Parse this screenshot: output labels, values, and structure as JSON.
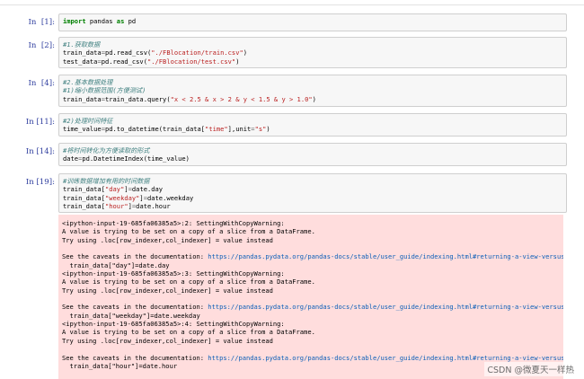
{
  "cells": [
    {
      "prompt": "In  [1]:",
      "lines": [
        [
          {
            "t": "import",
            "c": "kw"
          },
          {
            "t": " pandas "
          },
          {
            "t": "as",
            "c": "kw"
          },
          {
            "t": " pd"
          }
        ]
      ]
    },
    {
      "prompt": "In  [2]:",
      "lines": [
        [
          {
            "t": "#1.获取数据",
            "c": "cm"
          }
        ],
        [
          {
            "t": "train_data"
          },
          {
            "t": "=",
            "c": "nm"
          },
          {
            "t": "pd.read_csv("
          },
          {
            "t": "\"./FBlocation/train.csv\"",
            "c": "st"
          },
          {
            "t": ")"
          }
        ],
        [
          {
            "t": "test_data"
          },
          {
            "t": "=",
            "c": "nm"
          },
          {
            "t": "pd.read_csv("
          },
          {
            "t": "\"./FBlocation/test.csv\"",
            "c": "st"
          },
          {
            "t": ")"
          }
        ]
      ]
    },
    {
      "prompt": "In  [4]:",
      "lines": [
        [
          {
            "t": "#2.基本数据处理",
            "c": "cm"
          }
        ],
        [
          {
            "t": "#1)缩小数据范围(方便测试)",
            "c": "cm"
          }
        ],
        [
          {
            "t": "train_data"
          },
          {
            "t": "=",
            "c": "nm"
          },
          {
            "t": "train_data.query("
          },
          {
            "t": "\"x < 2.5 & x > 2 & y < 1.5 & y > 1.0\"",
            "c": "st"
          },
          {
            "t": ")"
          }
        ]
      ]
    },
    {
      "prompt": "In [11]:",
      "lines": [
        [
          {
            "t": "#2)处理时间特征",
            "c": "cm"
          }
        ],
        [
          {
            "t": "time_value"
          },
          {
            "t": "=",
            "c": "nm"
          },
          {
            "t": "pd.to_datetime(train_data["
          },
          {
            "t": "\"time\"",
            "c": "st"
          },
          {
            "t": "],unit"
          },
          {
            "t": "=",
            "c": "nm"
          },
          {
            "t": "\"s\"",
            "c": "st"
          },
          {
            "t": ")"
          }
        ]
      ]
    },
    {
      "prompt": "In [14]:",
      "lines": [
        [
          {
            "t": "#将时间转化为方便读取的形式",
            "c": "cm"
          }
        ],
        [
          {
            "t": "date"
          },
          {
            "t": "=",
            "c": "nm"
          },
          {
            "t": "pd.DatetimeIndex(time_value)"
          }
        ]
      ]
    },
    {
      "prompt": "In [19]:",
      "lines": [
        [
          {
            "t": "#训练数据增加有用的时间数据",
            "c": "cm"
          }
        ],
        [
          {
            "t": "train_data["
          },
          {
            "t": "\"day\"",
            "c": "st"
          },
          {
            "t": "]"
          },
          {
            "t": "=",
            "c": "nm"
          },
          {
            "t": "date.day"
          }
        ],
        [
          {
            "t": "train_data["
          },
          {
            "t": "\"weekday\"",
            "c": "st"
          },
          {
            "t": "]"
          },
          {
            "t": "=",
            "c": "nm"
          },
          {
            "t": "date.weekday"
          }
        ],
        [
          {
            "t": "train_data["
          },
          {
            "t": "\"hour\"",
            "c": "st"
          },
          {
            "t": "]"
          },
          {
            "t": "=",
            "c": "nm"
          },
          {
            "t": "date.hour"
          }
        ]
      ]
    }
  ],
  "output": {
    "lines": [
      [
        {
          "t": "<ipython-input-19-685fa06385a5>:2: SettingWithCopyWarning:"
        }
      ],
      [
        {
          "t": "A value is trying to be set on a copy of a slice from a DataFrame."
        }
      ],
      [
        {
          "t": "Try using .loc[row_indexer,col_indexer] = value instead"
        }
      ],
      [
        {
          "t": ""
        }
      ],
      [
        {
          "t": "See the caveats in the documentation: "
        },
        {
          "t": "https://pandas.pydata.org/pandas-docs/stable/user_guide/indexing.html#returning-a-view-versus-a-copy",
          "c": "link"
        }
      ],
      [
        {
          "t": "  train_data[\"day\"]=date.day"
        }
      ],
      [
        {
          "t": "<ipython-input-19-685fa06385a5>:3: SettingWithCopyWarning:"
        }
      ],
      [
        {
          "t": "A value is trying to be set on a copy of a slice from a DataFrame."
        }
      ],
      [
        {
          "t": "Try using .loc[row_indexer,col_indexer] = value instead"
        }
      ],
      [
        {
          "t": ""
        }
      ],
      [
        {
          "t": "See the caveats in the documentation: "
        },
        {
          "t": "https://pandas.pydata.org/pandas-docs/stable/user_guide/indexing.html#returning-a-view-versus-a-copy",
          "c": "link"
        }
      ],
      [
        {
          "t": "  train_data[\"weekday\"]=date.weekday"
        }
      ],
      [
        {
          "t": "<ipython-input-19-685fa06385a5>:4: SettingWithCopyWarning:"
        }
      ],
      [
        {
          "t": "A value is trying to be set on a copy of a slice from a DataFrame."
        }
      ],
      [
        {
          "t": "Try using .loc[row_indexer,col_indexer] = value instead"
        }
      ],
      [
        {
          "t": ""
        }
      ],
      [
        {
          "t": "See the caveats in the documentation: "
        },
        {
          "t": "https://pandas.pydata.org/pandas-docs/stable/user_guide/indexing.html#returning-a-view-versus-a-copy",
          "c": "link"
        }
      ],
      [
        {
          "t": "  train_data[\"hour\"]=date.hour"
        }
      ]
    ]
  },
  "watermark": "CSDN @微夏天一样热",
  "colors": {
    "prompt": "#303f9f",
    "keyword": "#008000",
    "comment": "#408080",
    "string": "#ba2121",
    "operator": "#666666",
    "stderr_bg": "#ffdddd",
    "link": "#0b5fb8"
  }
}
